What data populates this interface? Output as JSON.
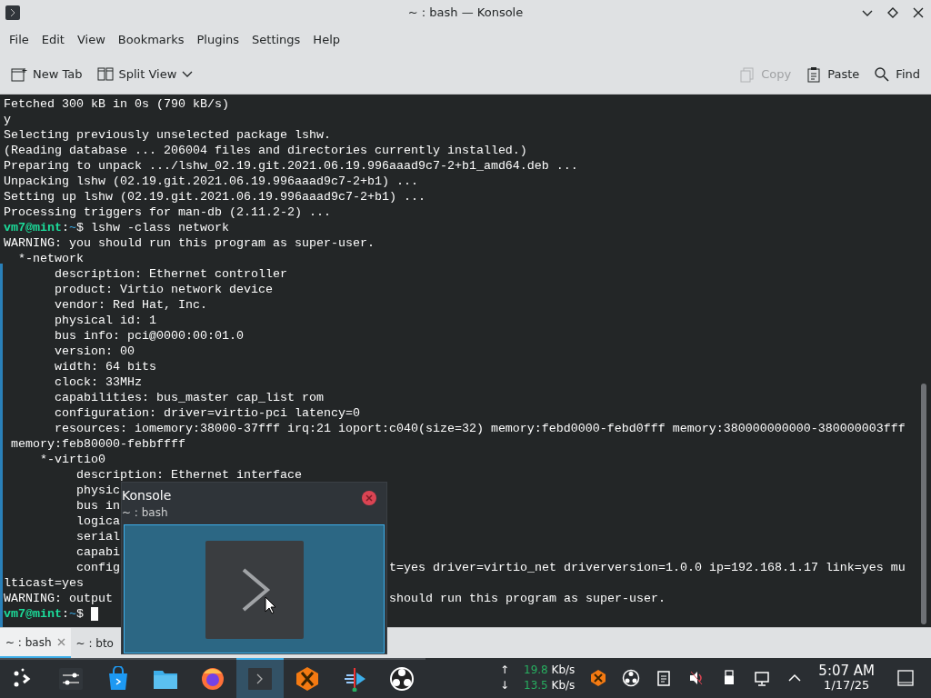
{
  "window": {
    "title": "~ : bash — Konsole"
  },
  "menu": [
    "File",
    "Edit",
    "View",
    "Bookmarks",
    "Plugins",
    "Settings",
    "Help"
  ],
  "toolbar": [
    {
      "kind": "new-tab",
      "label": "New Tab",
      "disabled": false
    },
    {
      "kind": "split",
      "label": "Split View",
      "disabled": false
    },
    {
      "kind": "copy",
      "label": "Copy",
      "disabled": true
    },
    {
      "kind": "paste",
      "label": "Paste",
      "disabled": false
    },
    {
      "kind": "find",
      "label": "Find",
      "disabled": false
    }
  ],
  "terminal": {
    "lines": [
      {
        "kind": "text",
        "text": "Fetched 300 kB in 0s (790 kB/s)"
      },
      {
        "kind": "text",
        "text": "y"
      },
      {
        "kind": "text",
        "text": "Selecting previously unselected package lshw."
      },
      {
        "kind": "text",
        "text": "(Reading database ... 206004 files and directories currently installed.)"
      },
      {
        "kind": "text",
        "text": "Preparing to unpack .../lshw_02.19.git.2021.06.19.996aaad9c7-2+b1_amd64.deb ..."
      },
      {
        "kind": "text",
        "text": "Unpacking lshw (02.19.git.2021.06.19.996aaad9c7-2+b1) ..."
      },
      {
        "kind": "text",
        "text": "Setting up lshw (02.19.git.2021.06.19.996aaad9c7-2+b1) ..."
      },
      {
        "kind": "text",
        "text": "Processing triggers for man-db (2.11.2-2) ..."
      },
      {
        "kind": "prompt",
        "user": "vm7@mint",
        "sep": ":",
        "path": "~",
        "command": "$ lshw -class network",
        "cursor": false
      },
      {
        "kind": "text",
        "text": "WARNING: you should run this program as super-user."
      },
      {
        "kind": "text",
        "text": "  *-network"
      },
      {
        "kind": "text",
        "text": "       description: Ethernet controller"
      },
      {
        "kind": "text",
        "text": "       product: Virtio network device"
      },
      {
        "kind": "text",
        "text": "       vendor: Red Hat, Inc."
      },
      {
        "kind": "text",
        "text": "       physical id: 1"
      },
      {
        "kind": "text",
        "text": "       bus info: pci@0000:00:01.0"
      },
      {
        "kind": "text",
        "text": "       version: 00"
      },
      {
        "kind": "text",
        "text": "       width: 64 bits"
      },
      {
        "kind": "text",
        "text": "       clock: 33MHz"
      },
      {
        "kind": "text",
        "text": "       capabilities: bus_master cap_list rom"
      },
      {
        "kind": "text",
        "text": "       configuration: driver=virtio-pci latency=0"
      },
      {
        "kind": "text",
        "text": "       resources: iomemory:38000-37fff irq:21 ioport:c040(size=32) memory:febd0000-febd0fff memory:380000000000-380000003fff"
      },
      {
        "kind": "text",
        "text": " memory:feb80000-febbffff"
      },
      {
        "kind": "text",
        "text": "     *-virtio0"
      },
      {
        "kind": "text",
        "text": "          description: Ethernet interface"
      },
      {
        "kind": "text",
        "text": "          physic"
      },
      {
        "kind": "text",
        "text": "          bus in"
      },
      {
        "kind": "text",
        "text": "          logica"
      },
      {
        "kind": "text",
        "text": "          serial"
      },
      {
        "kind": "text",
        "text": "          capabi"
      },
      {
        "kind": "text",
        "text": "          config",
        "right": "t=yes driver=virtio_net driverversion=1.0.0 ip=192.168.1.17 link=yes mu"
      },
      {
        "kind": "text",
        "text": "lticast=yes"
      },
      {
        "kind": "text",
        "text": "WARNING: output",
        "right": "should run this program as super-user."
      },
      {
        "kind": "prompt",
        "user": "vm7@mint",
        "sep": ":",
        "path": "~",
        "command": "$ ",
        "cursor": true
      }
    ]
  },
  "tabs": [
    {
      "label": "~ : bash",
      "selected": true,
      "closable": true
    },
    {
      "label": "~ : bto",
      "selected": false,
      "closable": false
    }
  ],
  "popup": {
    "title": "Konsole",
    "subtitle": "~ : bash"
  },
  "taskbar": {
    "apps": [
      {
        "kind": "launcher",
        "selected": false
      },
      {
        "kind": "mixer",
        "selected": false
      },
      {
        "kind": "store",
        "selected": false
      },
      {
        "kind": "folder",
        "selected": false
      },
      {
        "kind": "browser",
        "selected": false
      },
      {
        "kind": "terminal",
        "selected": true
      },
      {
        "kind": "hex",
        "selected": false
      },
      {
        "kind": "editor",
        "selected": false
      },
      {
        "kind": "ring",
        "selected": false
      }
    ],
    "network": [
      {
        "arrow": "↑",
        "value": "19.8",
        "unit": "Kb/s"
      },
      {
        "arrow": "↓",
        "value": "13.5",
        "unit": "Kb/s"
      }
    ],
    "clock": {
      "time": "5:07 AM",
      "date": "1/17/25"
    }
  }
}
